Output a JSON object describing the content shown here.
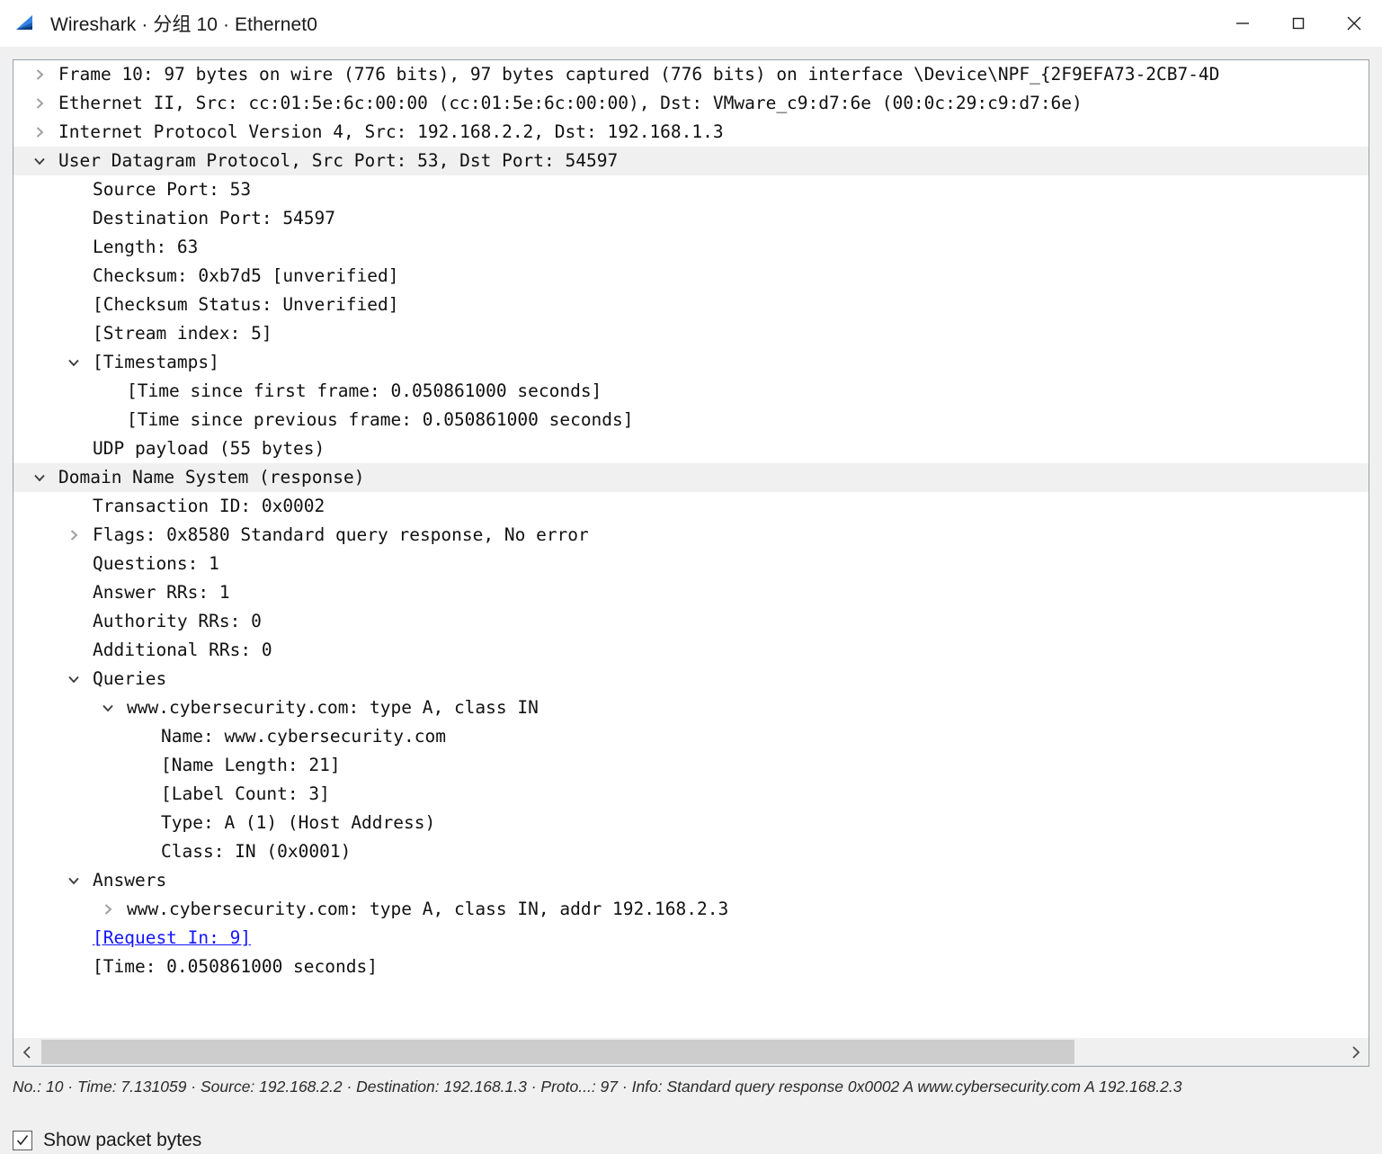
{
  "window": {
    "title": "Wireshark · 分组 10 · Ethernet0",
    "app_icon": "wireshark-fin-icon",
    "controls": {
      "minimize": "minimize-icon",
      "maximize": "maximize-icon",
      "close": "close-icon"
    }
  },
  "tree": {
    "rows": [
      {
        "level": 0,
        "state": "collapsed",
        "selected": false,
        "text": "Frame 10: 97 bytes on wire (776 bits), 97 bytes captured (776 bits) on interface \\Device\\NPF_{2F9EFA73-2CB7-4D"
      },
      {
        "level": 0,
        "state": "collapsed",
        "selected": false,
        "text": "Ethernet II, Src: cc:01:5e:6c:00:00 (cc:01:5e:6c:00:00), Dst: VMware_c9:d7:6e (00:0c:29:c9:d7:6e)"
      },
      {
        "level": 0,
        "state": "collapsed",
        "selected": false,
        "text": "Internet Protocol Version 4, Src: 192.168.2.2, Dst: 192.168.1.3"
      },
      {
        "level": 0,
        "state": "expanded",
        "selected": true,
        "text": "User Datagram Protocol, Src Port: 53, Dst Port: 54597"
      },
      {
        "level": 1,
        "state": "leaf",
        "selected": false,
        "text": "Source Port: 53"
      },
      {
        "level": 1,
        "state": "leaf",
        "selected": false,
        "text": "Destination Port: 54597"
      },
      {
        "level": 1,
        "state": "leaf",
        "selected": false,
        "text": "Length: 63"
      },
      {
        "level": 1,
        "state": "leaf",
        "selected": false,
        "text": "Checksum: 0xb7d5 [unverified]"
      },
      {
        "level": 1,
        "state": "leaf",
        "selected": false,
        "text": "[Checksum Status: Unverified]"
      },
      {
        "level": 1,
        "state": "leaf",
        "selected": false,
        "text": "[Stream index: 5]"
      },
      {
        "level": 1,
        "state": "expanded",
        "selected": false,
        "text": "[Timestamps]"
      },
      {
        "level": 2,
        "state": "leaf",
        "selected": false,
        "text": "[Time since first frame: 0.050861000 seconds]"
      },
      {
        "level": 2,
        "state": "leaf",
        "selected": false,
        "text": "[Time since previous frame: 0.050861000 seconds]"
      },
      {
        "level": 1,
        "state": "leaf",
        "selected": false,
        "text": "UDP payload (55 bytes)"
      },
      {
        "level": 0,
        "state": "expanded",
        "selected": true,
        "text": "Domain Name System (response)"
      },
      {
        "level": 1,
        "state": "leaf",
        "selected": false,
        "text": "Transaction ID: 0x0002"
      },
      {
        "level": 1,
        "state": "collapsed",
        "selected": false,
        "text": "Flags: 0x8580 Standard query response, No error"
      },
      {
        "level": 1,
        "state": "leaf",
        "selected": false,
        "text": "Questions: 1"
      },
      {
        "level": 1,
        "state": "leaf",
        "selected": false,
        "text": "Answer RRs: 1"
      },
      {
        "level": 1,
        "state": "leaf",
        "selected": false,
        "text": "Authority RRs: 0"
      },
      {
        "level": 1,
        "state": "leaf",
        "selected": false,
        "text": "Additional RRs: 0"
      },
      {
        "level": 1,
        "state": "expanded",
        "selected": false,
        "text": "Queries"
      },
      {
        "level": 2,
        "state": "expanded",
        "selected": false,
        "text": "www.cybersecurity.com: type A, class IN"
      },
      {
        "level": 3,
        "state": "leaf",
        "selected": false,
        "text": "Name: www.cybersecurity.com"
      },
      {
        "level": 3,
        "state": "leaf",
        "selected": false,
        "text": "[Name Length: 21]"
      },
      {
        "level": 3,
        "state": "leaf",
        "selected": false,
        "text": "[Label Count: 3]"
      },
      {
        "level": 3,
        "state": "leaf",
        "selected": false,
        "text": "Type: A (1) (Host Address)"
      },
      {
        "level": 3,
        "state": "leaf",
        "selected": false,
        "text": "Class: IN (0x0001)"
      },
      {
        "level": 1,
        "state": "expanded",
        "selected": false,
        "text": "Answers"
      },
      {
        "level": 2,
        "state": "collapsed",
        "selected": false,
        "text": "www.cybersecurity.com: type A, class IN, addr 192.168.2.3"
      },
      {
        "level": 1,
        "state": "leaf",
        "selected": false,
        "link": true,
        "text": "[Request In: 9]"
      },
      {
        "level": 1,
        "state": "leaf",
        "selected": false,
        "text": "[Time: 0.050861000 seconds]"
      }
    ]
  },
  "scrollbar": {
    "left_arrow": "chevron-left-icon",
    "right_arrow": "chevron-right-icon",
    "thumb_fraction": 0.795
  },
  "status": {
    "text": "No.: 10 · Time: 7.131059 · Source: 192.168.2.2 · Destination: 192.168.1.3 · Proto...: 97 · Info: Standard query response 0x0002 A www.cybersecurity.com A 192.168.2.3"
  },
  "footer": {
    "show_packet_bytes_label": "Show packet bytes",
    "show_packet_bytes_checked": true
  },
  "colors": {
    "selection": "#f0f0f0",
    "link": "#1414ff",
    "panel_border": "#9aa0a6",
    "window_bg": "#f0f0f0"
  }
}
